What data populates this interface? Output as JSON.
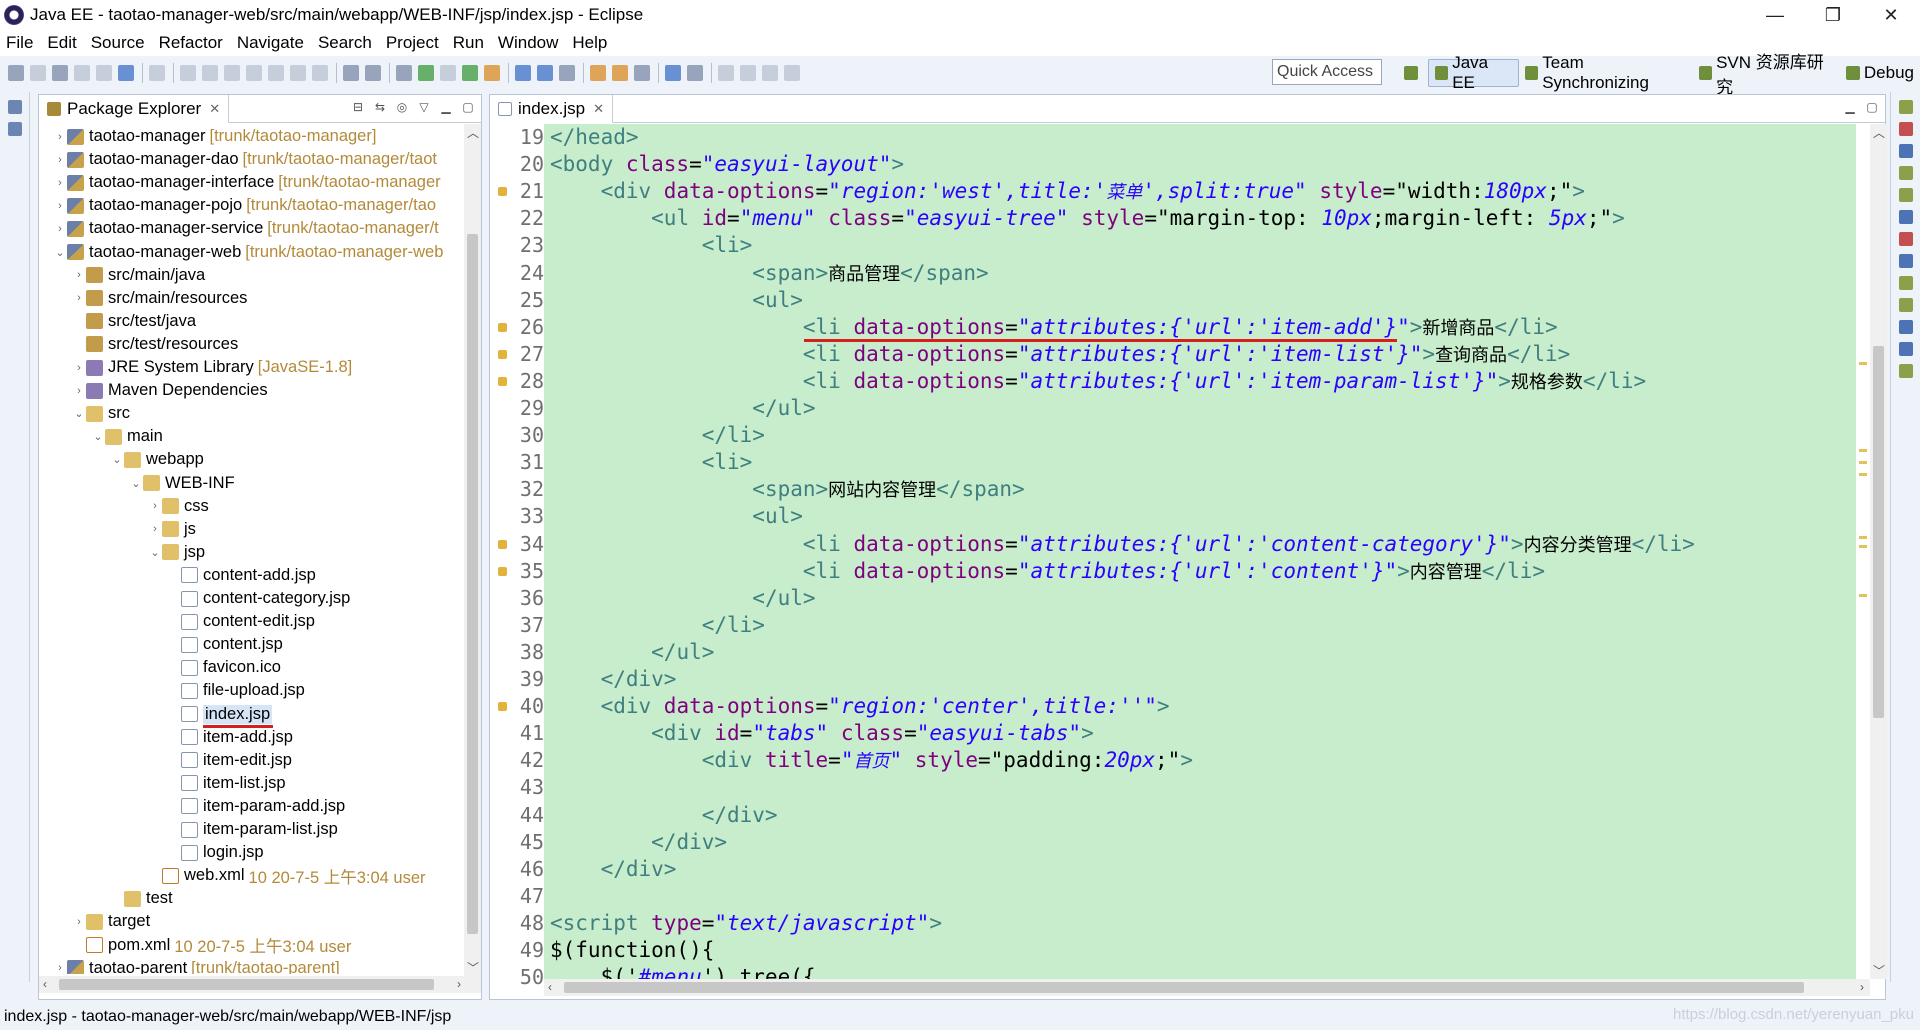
{
  "window": {
    "title": "Java EE - taotao-manager-web/src/main/webapp/WEB-INF/jsp/index.jsp - Eclipse",
    "controls": [
      "—",
      "❐",
      "✕"
    ]
  },
  "menu": [
    "File",
    "Edit",
    "Source",
    "Refactor",
    "Navigate",
    "Search",
    "Project",
    "Run",
    "Window",
    "Help"
  ],
  "quick_access": "Quick Access",
  "perspectives": [
    "Java EE",
    "Team Synchronizing",
    "SVN 资源库研究",
    "Debug"
  ],
  "package_explorer": {
    "tab": "Package Explorer",
    "close": "✕",
    "tree": [
      {
        "indent": 0,
        "arrow": "›",
        "icon": "proj",
        "label": "taotao-manager",
        "deco": "[trunk/taotao-manager]"
      },
      {
        "indent": 0,
        "arrow": "›",
        "icon": "proj",
        "label": "taotao-manager-dao",
        "deco": "[trunk/taotao-manager/taot"
      },
      {
        "indent": 0,
        "arrow": "›",
        "icon": "proj",
        "label": "taotao-manager-interface",
        "deco": "[trunk/taotao-manager"
      },
      {
        "indent": 0,
        "arrow": "›",
        "icon": "proj",
        "label": "taotao-manager-pojo",
        "deco": "[trunk/taotao-manager/tao"
      },
      {
        "indent": 0,
        "arrow": "›",
        "icon": "proj",
        "label": "taotao-manager-service",
        "deco": "[trunk/taotao-manager/t"
      },
      {
        "indent": 0,
        "arrow": "⌄",
        "icon": "proj",
        "label": "taotao-manager-web",
        "deco": "[trunk/taotao-manager-web"
      },
      {
        "indent": 1,
        "arrow": "›",
        "icon": "pkgf",
        "label": "src/main/java",
        "deco": ""
      },
      {
        "indent": 1,
        "arrow": "›",
        "icon": "pkgf",
        "label": "src/main/resources",
        "deco": ""
      },
      {
        "indent": 1,
        "arrow": "",
        "icon": "pkgf",
        "label": "src/test/java",
        "deco": ""
      },
      {
        "indent": 1,
        "arrow": "",
        "icon": "pkgf",
        "label": "src/test/resources",
        "deco": ""
      },
      {
        "indent": 1,
        "arrow": "›",
        "icon": "lib",
        "label": "JRE System Library",
        "deco": "[JavaSE-1.8]"
      },
      {
        "indent": 1,
        "arrow": "›",
        "icon": "lib",
        "label": "Maven Dependencies",
        "deco": ""
      },
      {
        "indent": 1,
        "arrow": "⌄",
        "icon": "fold",
        "label": "src",
        "deco": ""
      },
      {
        "indent": 2,
        "arrow": "⌄",
        "icon": "fold",
        "label": "main",
        "deco": ""
      },
      {
        "indent": 3,
        "arrow": "⌄",
        "icon": "fold",
        "label": "webapp",
        "deco": ""
      },
      {
        "indent": 4,
        "arrow": "⌄",
        "icon": "fold",
        "label": "WEB-INF",
        "deco": ""
      },
      {
        "indent": 5,
        "arrow": "›",
        "icon": "fold",
        "label": "css",
        "deco": ""
      },
      {
        "indent": 5,
        "arrow": "›",
        "icon": "fold",
        "label": "js",
        "deco": ""
      },
      {
        "indent": 5,
        "arrow": "⌄",
        "icon": "fold",
        "label": "jsp",
        "deco": ""
      },
      {
        "indent": 6,
        "arrow": "",
        "icon": "file",
        "label": "content-add.jsp",
        "deco": ""
      },
      {
        "indent": 6,
        "arrow": "",
        "icon": "file",
        "label": "content-category.jsp",
        "deco": ""
      },
      {
        "indent": 6,
        "arrow": "",
        "icon": "file",
        "label": "content-edit.jsp",
        "deco": ""
      },
      {
        "indent": 6,
        "arrow": "",
        "icon": "file",
        "label": "content.jsp",
        "deco": ""
      },
      {
        "indent": 6,
        "arrow": "",
        "icon": "file",
        "label": "favicon.ico",
        "deco": ""
      },
      {
        "indent": 6,
        "arrow": "",
        "icon": "file",
        "label": "file-upload.jsp",
        "deco": ""
      },
      {
        "indent": 6,
        "arrow": "",
        "icon": "file",
        "label": "index.jsp",
        "deco": "",
        "selected": true
      },
      {
        "indent": 6,
        "arrow": "",
        "icon": "file",
        "label": "item-add.jsp",
        "deco": ""
      },
      {
        "indent": 6,
        "arrow": "",
        "icon": "file",
        "label": "item-edit.jsp",
        "deco": ""
      },
      {
        "indent": 6,
        "arrow": "",
        "icon": "file",
        "label": "item-list.jsp",
        "deco": ""
      },
      {
        "indent": 6,
        "arrow": "",
        "icon": "file",
        "label": "item-param-add.jsp",
        "deco": ""
      },
      {
        "indent": 6,
        "arrow": "",
        "icon": "file",
        "label": "item-param-list.jsp",
        "deco": ""
      },
      {
        "indent": 6,
        "arrow": "",
        "icon": "file",
        "label": "login.jsp",
        "deco": ""
      },
      {
        "indent": 5,
        "arrow": "",
        "icon": "xml",
        "label": "web.xml",
        "deco": "10  20-7-5 上午3:04  user"
      },
      {
        "indent": 3,
        "arrow": "",
        "icon": "fold",
        "label": "test",
        "deco": ""
      },
      {
        "indent": 1,
        "arrow": "›",
        "icon": "fold",
        "label": "target",
        "deco": ""
      },
      {
        "indent": 1,
        "arrow": "",
        "icon": "xml",
        "label": "pom.xml",
        "deco": "10  20-7-5 上午3:04  user"
      },
      {
        "indent": 0,
        "arrow": "›",
        "icon": "proj",
        "label": "taotao-parent",
        "deco": "[trunk/taotao-parent]"
      }
    ]
  },
  "editor": {
    "tab": "index.jsp",
    "close": "✕",
    "lines": [
      {
        "n": "19",
        "w": false,
        "segs": [
          [
            "t",
            "</head>"
          ]
        ]
      },
      {
        "n": "20",
        "w": false,
        "segs": [
          [
            "t",
            "<body "
          ],
          [
            "a",
            "class"
          ],
          [
            "p",
            "="
          ],
          [
            "s",
            "\"easyui-layout\""
          ],
          [
            "t",
            ">"
          ]
        ]
      },
      {
        "n": "21",
        "w": true,
        "segs": [
          [
            "p",
            "    "
          ],
          [
            "t",
            "<div "
          ],
          [
            "a",
            "data-options"
          ],
          [
            "p",
            "="
          ],
          [
            "s",
            "\"region:'west',title:'"
          ],
          [
            "sj",
            "菜单"
          ],
          [
            "s",
            "',split:true\""
          ],
          [
            "p",
            " "
          ],
          [
            "a",
            "style"
          ],
          [
            "p",
            "=\"width:"
          ],
          [
            "s",
            "180px"
          ],
          [
            "p",
            ";\""
          ],
          [
            "t",
            ">"
          ]
        ]
      },
      {
        "n": "22",
        "w": false,
        "segs": [
          [
            "p",
            "        "
          ],
          [
            "t",
            "<ul "
          ],
          [
            "a",
            "id"
          ],
          [
            "p",
            "="
          ],
          [
            "s",
            "\"menu\""
          ],
          [
            "p",
            " "
          ],
          [
            "a",
            "class"
          ],
          [
            "p",
            "="
          ],
          [
            "s",
            "\"easyui-tree\""
          ],
          [
            "p",
            " "
          ],
          [
            "a",
            "style"
          ],
          [
            "p",
            "=\"margin-top: "
          ],
          [
            "s",
            "10px"
          ],
          [
            "p",
            ";margin-left: "
          ],
          [
            "s",
            "5px"
          ],
          [
            "p",
            ";\""
          ],
          [
            "t",
            ">"
          ]
        ]
      },
      {
        "n": "23",
        "w": false,
        "segs": [
          [
            "p",
            "            "
          ],
          [
            "t",
            "<li>"
          ]
        ]
      },
      {
        "n": "24",
        "w": false,
        "segs": [
          [
            "p",
            "                "
          ],
          [
            "t",
            "<span>"
          ],
          [
            "cj",
            "商品管理"
          ],
          [
            "t",
            "</span>"
          ]
        ]
      },
      {
        "n": "25",
        "w": false,
        "segs": [
          [
            "p",
            "                "
          ],
          [
            "t",
            "<ul>"
          ]
        ]
      },
      {
        "n": "26",
        "w": true,
        "segs": [
          [
            "p",
            "                    "
          ],
          [
            "t",
            "<li "
          ],
          [
            "a",
            "data-options"
          ],
          [
            "p",
            "="
          ],
          [
            "s",
            "\"attributes:{'url':'item-add'}\""
          ],
          [
            "t",
            ">"
          ],
          [
            "cj",
            "新增商品"
          ],
          [
            "t",
            "</li>"
          ]
        ]
      },
      {
        "n": "27",
        "w": true,
        "segs": [
          [
            "p",
            "                    "
          ],
          [
            "t",
            "<li "
          ],
          [
            "a",
            "data-options"
          ],
          [
            "p",
            "="
          ],
          [
            "s",
            "\"attributes:{'url':'item-list'}\""
          ],
          [
            "t",
            ">"
          ],
          [
            "cj",
            "查询商品"
          ],
          [
            "t",
            "</li>"
          ]
        ]
      },
      {
        "n": "28",
        "w": true,
        "segs": [
          [
            "p",
            "                    "
          ],
          [
            "t",
            "<li "
          ],
          [
            "a",
            "data-options"
          ],
          [
            "p",
            "="
          ],
          [
            "s",
            "\"attributes:{'url':'item-param-list'}\""
          ],
          [
            "t",
            ">"
          ],
          [
            "cj",
            "规格参数"
          ],
          [
            "t",
            "</li>"
          ]
        ]
      },
      {
        "n": "29",
        "w": false,
        "segs": [
          [
            "p",
            "                "
          ],
          [
            "t",
            "</ul>"
          ]
        ]
      },
      {
        "n": "30",
        "w": false,
        "segs": [
          [
            "p",
            "            "
          ],
          [
            "t",
            "</li>"
          ]
        ]
      },
      {
        "n": "31",
        "w": false,
        "segs": [
          [
            "p",
            "            "
          ],
          [
            "t",
            "<li>"
          ]
        ]
      },
      {
        "n": "32",
        "w": false,
        "segs": [
          [
            "p",
            "                "
          ],
          [
            "t",
            "<span>"
          ],
          [
            "cj",
            "网站内容管理"
          ],
          [
            "t",
            "</span>"
          ]
        ]
      },
      {
        "n": "33",
        "w": false,
        "segs": [
          [
            "p",
            "                "
          ],
          [
            "t",
            "<ul>"
          ]
        ]
      },
      {
        "n": "34",
        "w": true,
        "segs": [
          [
            "p",
            "                    "
          ],
          [
            "t",
            "<li "
          ],
          [
            "a",
            "data-options"
          ],
          [
            "p",
            "="
          ],
          [
            "s",
            "\"attributes:{'url':'content-category'}\""
          ],
          [
            "t",
            ">"
          ],
          [
            "cj",
            "内容分类管理"
          ],
          [
            "t",
            "</li>"
          ]
        ]
      },
      {
        "n": "35",
        "w": true,
        "segs": [
          [
            "p",
            "                    "
          ],
          [
            "t",
            "<li "
          ],
          [
            "a",
            "data-options"
          ],
          [
            "p",
            "="
          ],
          [
            "s",
            "\"attributes:{'url':'content'}\""
          ],
          [
            "t",
            ">"
          ],
          [
            "cj",
            "内容管理"
          ],
          [
            "t",
            "</li>"
          ]
        ]
      },
      {
        "n": "36",
        "w": false,
        "segs": [
          [
            "p",
            "                "
          ],
          [
            "t",
            "</ul>"
          ]
        ]
      },
      {
        "n": "37",
        "w": false,
        "segs": [
          [
            "p",
            "            "
          ],
          [
            "t",
            "</li>"
          ]
        ]
      },
      {
        "n": "38",
        "w": false,
        "segs": [
          [
            "p",
            "        "
          ],
          [
            "t",
            "</ul>"
          ]
        ]
      },
      {
        "n": "39",
        "w": false,
        "segs": [
          [
            "p",
            "    "
          ],
          [
            "t",
            "</div>"
          ]
        ]
      },
      {
        "n": "40",
        "w": true,
        "segs": [
          [
            "p",
            "    "
          ],
          [
            "t",
            "<div "
          ],
          [
            "a",
            "data-options"
          ],
          [
            "p",
            "="
          ],
          [
            "s",
            "\"region:'center',title:''\""
          ],
          [
            "t",
            ">"
          ]
        ]
      },
      {
        "n": "41",
        "w": false,
        "segs": [
          [
            "p",
            "        "
          ],
          [
            "t",
            "<div "
          ],
          [
            "a",
            "id"
          ],
          [
            "p",
            "="
          ],
          [
            "s",
            "\"tabs\""
          ],
          [
            "p",
            " "
          ],
          [
            "a",
            "class"
          ],
          [
            "p",
            "="
          ],
          [
            "s",
            "\"easyui-tabs\""
          ],
          [
            "t",
            ">"
          ]
        ]
      },
      {
        "n": "42",
        "w": false,
        "segs": [
          [
            "p",
            "            "
          ],
          [
            "t",
            "<div "
          ],
          [
            "a",
            "title"
          ],
          [
            "p",
            "="
          ],
          [
            "s",
            "\""
          ],
          [
            "sj",
            "首页"
          ],
          [
            "s",
            "\""
          ],
          [
            "p",
            " "
          ],
          [
            "a",
            "style"
          ],
          [
            "p",
            "=\"padding:"
          ],
          [
            "s",
            "20px"
          ],
          [
            "p",
            ";\""
          ],
          [
            "t",
            ">"
          ]
        ]
      },
      {
        "n": "43",
        "w": false,
        "segs": []
      },
      {
        "n": "44",
        "w": false,
        "segs": [
          [
            "p",
            "            "
          ],
          [
            "t",
            "</div>"
          ]
        ]
      },
      {
        "n": "45",
        "w": false,
        "segs": [
          [
            "p",
            "        "
          ],
          [
            "t",
            "</div>"
          ]
        ]
      },
      {
        "n": "46",
        "w": false,
        "segs": [
          [
            "p",
            "    "
          ],
          [
            "t",
            "</div>"
          ]
        ]
      },
      {
        "n": "47",
        "w": false,
        "segs": []
      },
      {
        "n": "48",
        "w": false,
        "segs": [
          [
            "t",
            "<script "
          ],
          [
            "a",
            "type"
          ],
          [
            "p",
            "="
          ],
          [
            "s",
            "\"text/javascript\""
          ],
          [
            "t",
            ">"
          ]
        ]
      },
      {
        "n": "49",
        "w": false,
        "segs": [
          [
            "p",
            "$(function(){"
          ]
        ]
      },
      {
        "n": "50",
        "w": false,
        "segs": [
          [
            "p",
            "    $('"
          ],
          [
            "s",
            "#menu"
          ],
          [
            "p",
            "').tree({"
          ]
        ]
      }
    ]
  },
  "status": "index.jsp - taotao-manager-web/src/main/webapp/WEB-INF/jsp",
  "watermark": "https://blog.csdn.net/yerenyuan_pku"
}
